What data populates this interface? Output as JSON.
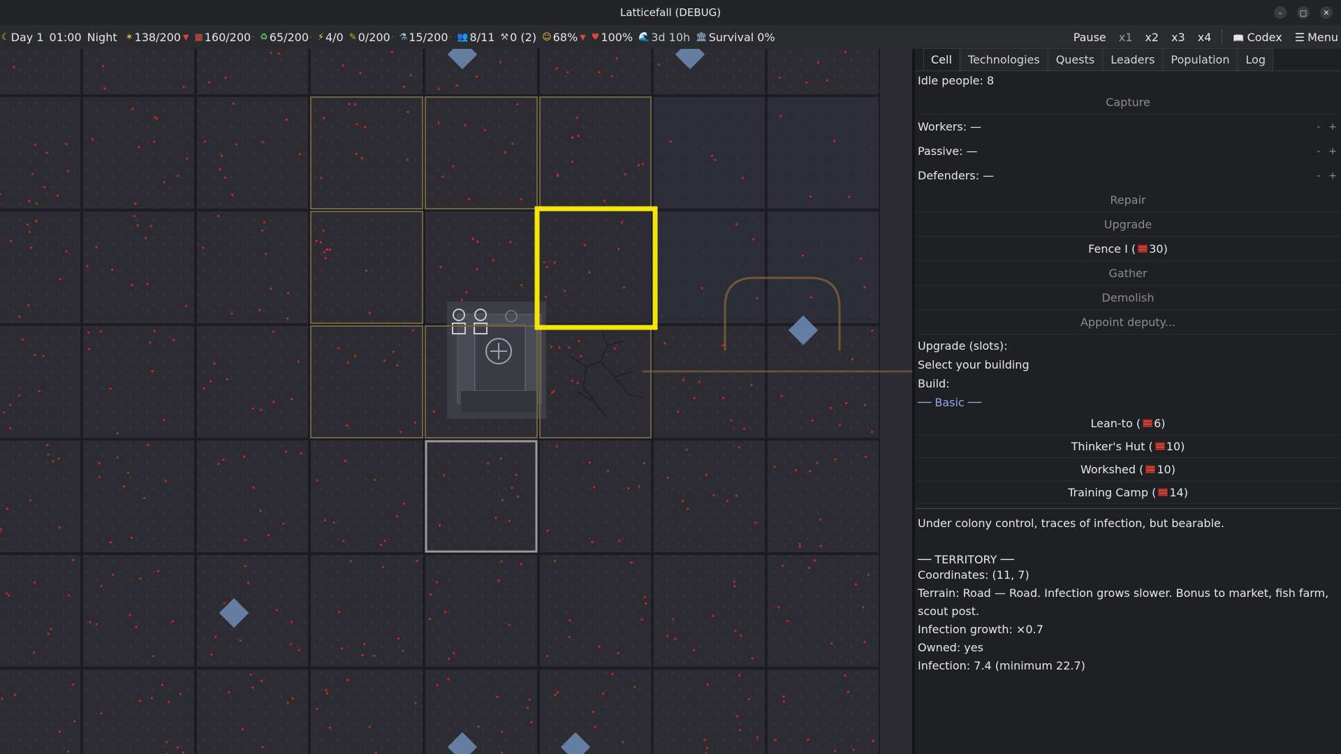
{
  "window": {
    "title": "Latticefall (DEBUG)"
  },
  "topbar": {
    "day": "Day 1",
    "time": "01:00",
    "phase": "Night",
    "food": "138/200",
    "materials": "160/200",
    "recycle": "65/200",
    "energy": "4/0",
    "medicine": "0/200",
    "science": "15/200",
    "people": "8/11",
    "tools": "0 (2)",
    "mood": "68%",
    "health": "100%",
    "wave": "3d 10h",
    "survival": "Survival 0%"
  },
  "controls": {
    "pause": "Pause",
    "x1": "x1",
    "x2": "x2",
    "x3": "x3",
    "x4": "x4",
    "codex": "Codex",
    "menu": "Menu"
  },
  "tabs": [
    "Cell",
    "Technologies",
    "Quests",
    "Leaders",
    "Population",
    "Log"
  ],
  "panel": {
    "idle": "Idle people: 8",
    "capture": "Capture",
    "workers": "Workers: —",
    "passive": "Passive: —",
    "defenders": "Defenders: —",
    "minus": "-",
    "plus": "+",
    "repair": "Repair",
    "upgrade": "Upgrade",
    "fence_label": "Fence I (",
    "fence_cost": "30)",
    "gather": "Gather",
    "demolish": "Demolish",
    "appoint": "Appoint deputy...",
    "upgrade_slots": "Upgrade (slots):",
    "select_building": "Select your building",
    "build": "Build:",
    "basic": "── Basic ──",
    "buildings": [
      {
        "name": "Lean-to (",
        "cost": "6)"
      },
      {
        "name": "Thinker's Hut (",
        "cost": "10)"
      },
      {
        "name": "Workshed (",
        "cost": "10)"
      },
      {
        "name": "Training Camp (",
        "cost": "14)"
      }
    ],
    "description": "Under colony control, traces of infection, but bearable.",
    "territory_header": "── TERRITORY ──",
    "coordinates": "Coordinates: (11, 7)",
    "terrain": "Terrain: Road — Road. Infection grows slower. Bonus to market, fish farm, scout post.",
    "infection_growth": "Infection growth: ×0.7",
    "owned": "Owned: yes",
    "infection": "Infection: 7.4  (minimum 22.7)"
  },
  "colors": {
    "selection": "#f2e40c",
    "owned_border": "#6e6342",
    "hover_border": "#9a9a9a",
    "diamond": "#6c86ad",
    "infection_dot": "#c42a2a"
  }
}
